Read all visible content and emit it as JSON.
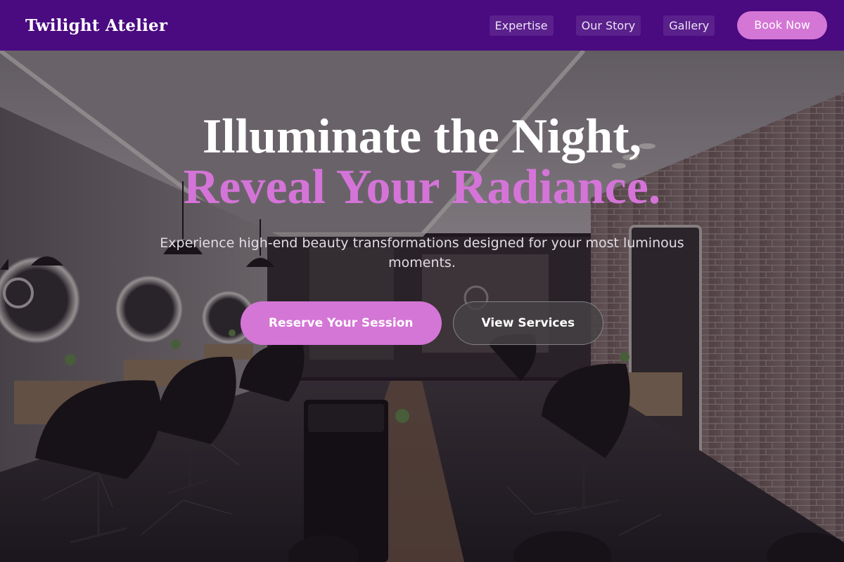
{
  "header": {
    "brand": "Twilight Atelier",
    "nav": [
      {
        "label": "Expertise"
      },
      {
        "label": "Our Story"
      },
      {
        "label": "Gallery"
      }
    ],
    "cta_label": "Book Now"
  },
  "hero": {
    "headline_line1": "Illuminate the Night,",
    "headline_line2": "Reveal Your Radiance.",
    "subtitle": "Experience high-end beauty transformations designed for your most luminous moments.",
    "primary_cta": "Reserve Your Session",
    "secondary_cta": "View Services",
    "background_image": "salon-interior-photo"
  },
  "colors": {
    "header_bg": "#4a0a80",
    "accent": "#d476d6",
    "headline_accent": "#d574d8",
    "text": "#ffffff"
  }
}
